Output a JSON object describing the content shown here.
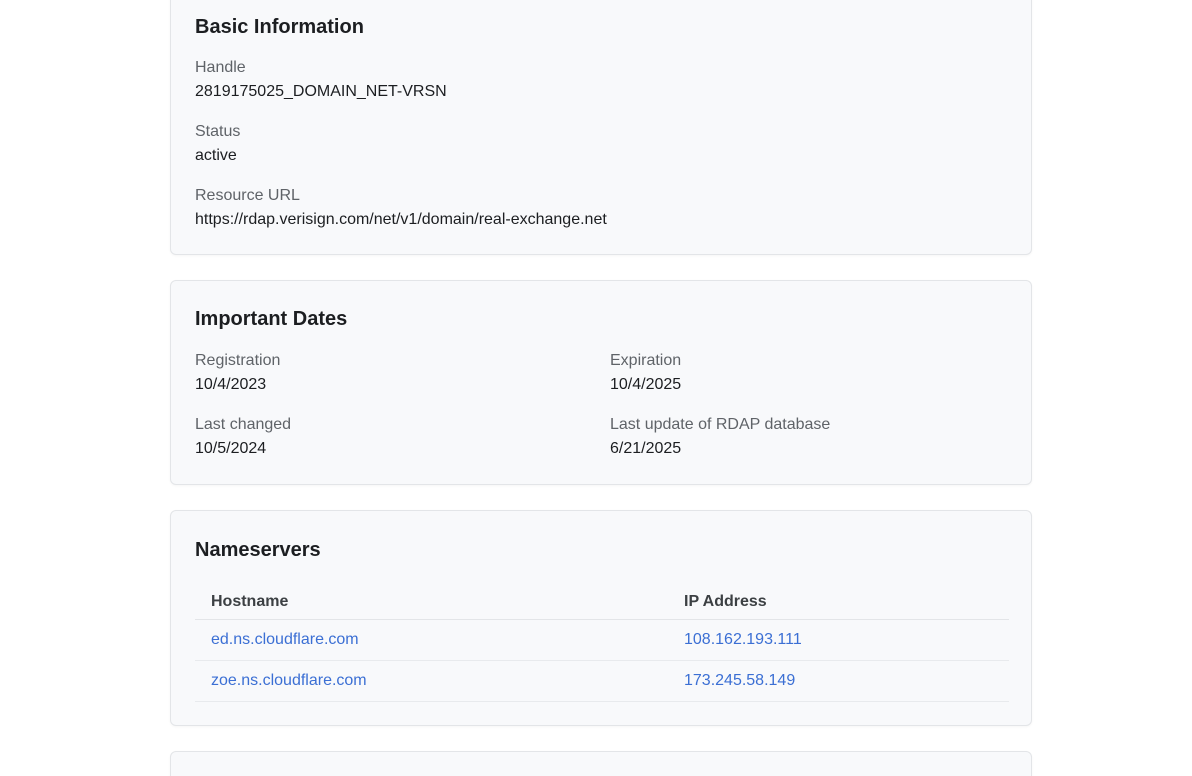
{
  "basic_info": {
    "title": "Basic Information",
    "handle_label": "Handle",
    "handle_value": "2819175025_DOMAIN_NET-VRSN",
    "status_label": "Status",
    "status_value": "active",
    "resource_url_label": "Resource URL",
    "resource_url_value": "https://rdap.verisign.com/net/v1/domain/real-exchange.net"
  },
  "important_dates": {
    "title": "Important Dates",
    "registration_label": "Registration",
    "registration_value": "10/4/2023",
    "expiration_label": "Expiration",
    "expiration_value": "10/4/2025",
    "last_changed_label": "Last changed",
    "last_changed_value": "10/5/2024",
    "last_update_label": "Last update of RDAP database",
    "last_update_value": "6/21/2025"
  },
  "nameservers": {
    "title": "Nameservers",
    "columns": [
      "Hostname",
      "IP Address"
    ],
    "rows": [
      {
        "hostname": "ed.ns.cloudflare.com",
        "ip": "108.162.193.111"
      },
      {
        "hostname": "zoe.ns.cloudflare.com",
        "ip": "173.245.58.149"
      }
    ]
  },
  "colors": {
    "link": "#3b6fd4",
    "card_background": "#f8f9fb",
    "card_border": "#e3e5e8"
  }
}
